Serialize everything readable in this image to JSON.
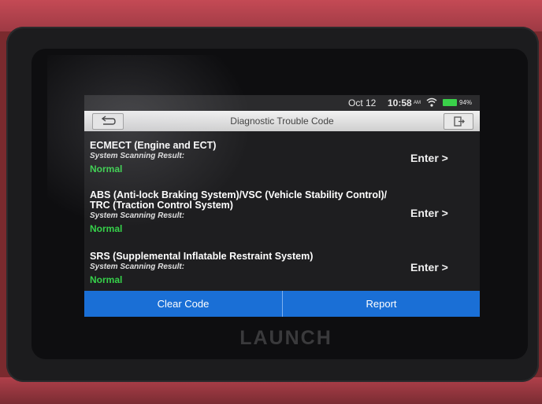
{
  "status_bar": {
    "date": "Oct 12",
    "time": "10:58",
    "ampm": "AM",
    "battery": "94%"
  },
  "header": {
    "title": "Diagnostic Trouble Code"
  },
  "systems": [
    {
      "name": "ECMECT (Engine and ECT)",
      "result_label": "System Scanning Result:",
      "status": "Normal",
      "action": "Enter >"
    },
    {
      "name_line1": "ABS (Anti-lock Braking System)/VSC (Vehicle Stability Control)/",
      "name_line2": "TRC (Traction Control System)",
      "result_label": "System Scanning Result:",
      "status": "Normal",
      "action": "Enter >"
    },
    {
      "name": "SRS (Supplemental Inflatable Restraint System)",
      "result_label": "System Scanning Result:",
      "status": "Normal",
      "action": "Enter >"
    }
  ],
  "buttons": {
    "clear_code": "Clear Code",
    "report": "Report"
  },
  "device": {
    "brand": "LAUNCH"
  },
  "colors": {
    "normal_status": "#36d14a",
    "action_bar": "#1a6fd6",
    "case": "#b0404a"
  }
}
